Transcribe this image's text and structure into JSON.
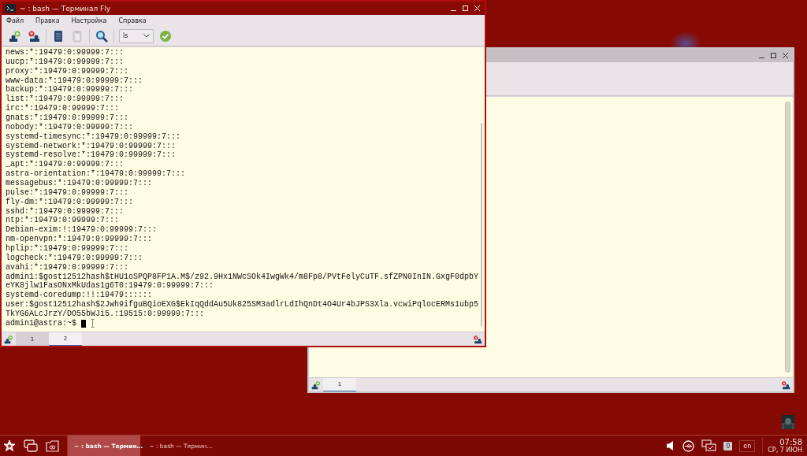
{
  "windows": [
    {
      "title": "~ : bash — Терминал Fly",
      "active": true,
      "menu": [
        "Файл",
        "Правка",
        "Настройка",
        "Справка"
      ],
      "toolbar": [
        {
          "kind": "new-tab",
          "disabled": false
        },
        {
          "kind": "close-tab",
          "disabled": false
        },
        {
          "kind": "sep"
        },
        {
          "kind": "copy",
          "disabled": false
        },
        {
          "kind": "paste",
          "disabled": true
        },
        {
          "kind": "sep"
        },
        {
          "kind": "search",
          "disabled": false
        },
        {
          "kind": "sep"
        },
        {
          "kind": "combo",
          "value": "ls"
        },
        {
          "kind": "run",
          "disabled": false
        }
      ],
      "lines": [
        "news:*:19479:0:99999:7:::",
        "uucp:*:19479:0:99999:7:::",
        "proxy:*:19479:0:99999:7:::",
        "www-data:*:19479:0:99999:7:::",
        "backup:*:19479:0:99999:7:::",
        "list:*:19479:0:99999:7:::",
        "irc:*:19479:0:99999:7:::",
        "gnats:*:19479:0:99999:7:::",
        "nobody:*:19479:0:99999:7:::",
        "systemd-timesync:*:19479:0:99999:7:::",
        "systemd-network:*:19479:0:99999:7:::",
        "systemd-resolve:*:19479:0:99999:7:::",
        "_apt:*:19479:0:99999:7:::",
        "astra-orientation:*:19479:0:99999:7:::",
        "messagebus:*:19479:0:99999:7:::",
        "pulse:*:19479:0:99999:7:::",
        "fly-dm:*:19479:0:99999:7:::",
        "sshd:*:19479:0:99999:7:::",
        "ntp:*:19479:0:99999:7:::",
        "Debian-exim:!:19479:0:99999:7:::",
        "nm-openvpn:*:19479:0:99999:7:::",
        "hplip:*:19479:0:99999:7:::",
        "logcheck:*:19479:0:99999:7:::",
        "avahi:*:19479:0:99999:7:::",
        "admin1:$gost12512hash$tHU1oSPQP8FP1A.M$/z92.9Hx1NWcSOk4IwgWk4/m8Fp8/PVtFelyCuTF.sfZPN0InIN.GxgF0dpbY",
        "eYK8jlw1FasONxMkUdas1g6T0:19479:0:99999:7:::",
        "systemd-coredump:!!:19479::::::",
        "user:$gost12512hash$2Jwh9ifguBQioEXG$EkIqQddAu5Uk825SM3adlrLdIhQnDt4O4Ur4bJPS3Xla.vcwiPqlocERMs1ubp5",
        "TkYG6ALcJrzY/DO55bWJi5.:19515:0:99999:7:::"
      ],
      "prompt": "admin1@astra:~$",
      "tabs": [
        {
          "label": "1",
          "selected": false
        },
        {
          "label": "2",
          "selected": true
        }
      ]
    },
    {
      "active": false,
      "tabs": [
        {
          "label": "1",
          "selected": true
        }
      ]
    }
  ],
  "taskbar": {
    "items": [
      {
        "label": "~ : bash — Термин…",
        "active": true
      },
      {
        "label": "~ : bash — Термин…",
        "active": false
      }
    ],
    "notifications": "0",
    "layout": "en",
    "time": "07:58",
    "date": "СР, 7 ИЮН"
  }
}
